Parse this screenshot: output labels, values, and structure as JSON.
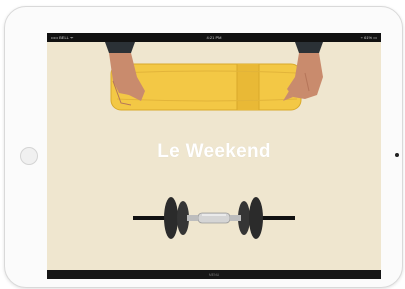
{
  "device": {
    "name": "tablet"
  },
  "status_bar": {
    "carrier": "••••• BELL ᯤ",
    "time": "4:21 PM",
    "battery": "⌁ 61% ▭"
  },
  "hero": {
    "title": "Le Weekend"
  },
  "bottom_bar": {
    "label": "MENU"
  },
  "colors": {
    "screen_background": "#efe6cf",
    "towel": "#f3c845",
    "dumbbell_plates": "#2b2b2b",
    "bars": "#111111"
  },
  "icons": {
    "home_button": "home-button-icon",
    "camera": "camera-icon"
  }
}
